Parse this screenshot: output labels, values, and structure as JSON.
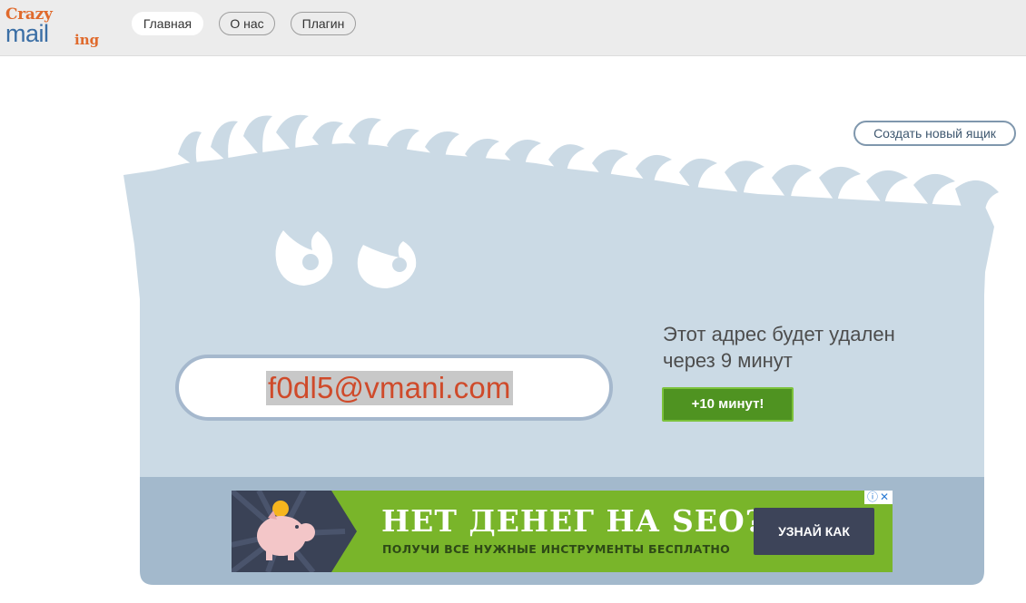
{
  "logo": {
    "word1": "Crazy",
    "word2": "mail",
    "word3": "ing"
  },
  "nav": {
    "items": [
      "Главная",
      "О нас",
      "Плагин"
    ],
    "active": "Главная"
  },
  "hero": {
    "new_box_button": "Создать новый ящик",
    "email": "f0dl5@vmani.com",
    "expire_line1": "Этот адрес будет удален",
    "expire_line2": "через 9 минут",
    "extend_button": "+10 минут!"
  },
  "ad": {
    "title": "НЕТ ДЕНЕГ НА SEO?",
    "subtitle": "ПОЛУЧИ ВСЕ НУЖНЫЕ ИНСТРУМЕНТЫ БЕСПЛАТНО",
    "button": "УЗНАЙ КАК",
    "info_icon": "info-icon",
    "close_icon": "close-icon"
  },
  "colors": {
    "header_bg": "#ececec",
    "monster": "#cbdae5",
    "band": "#a3b9cc",
    "email_text": "#cf4a2a",
    "extend_button": "#4f9321",
    "ad_green": "#79b52a",
    "ad_button": "#3d4459"
  }
}
